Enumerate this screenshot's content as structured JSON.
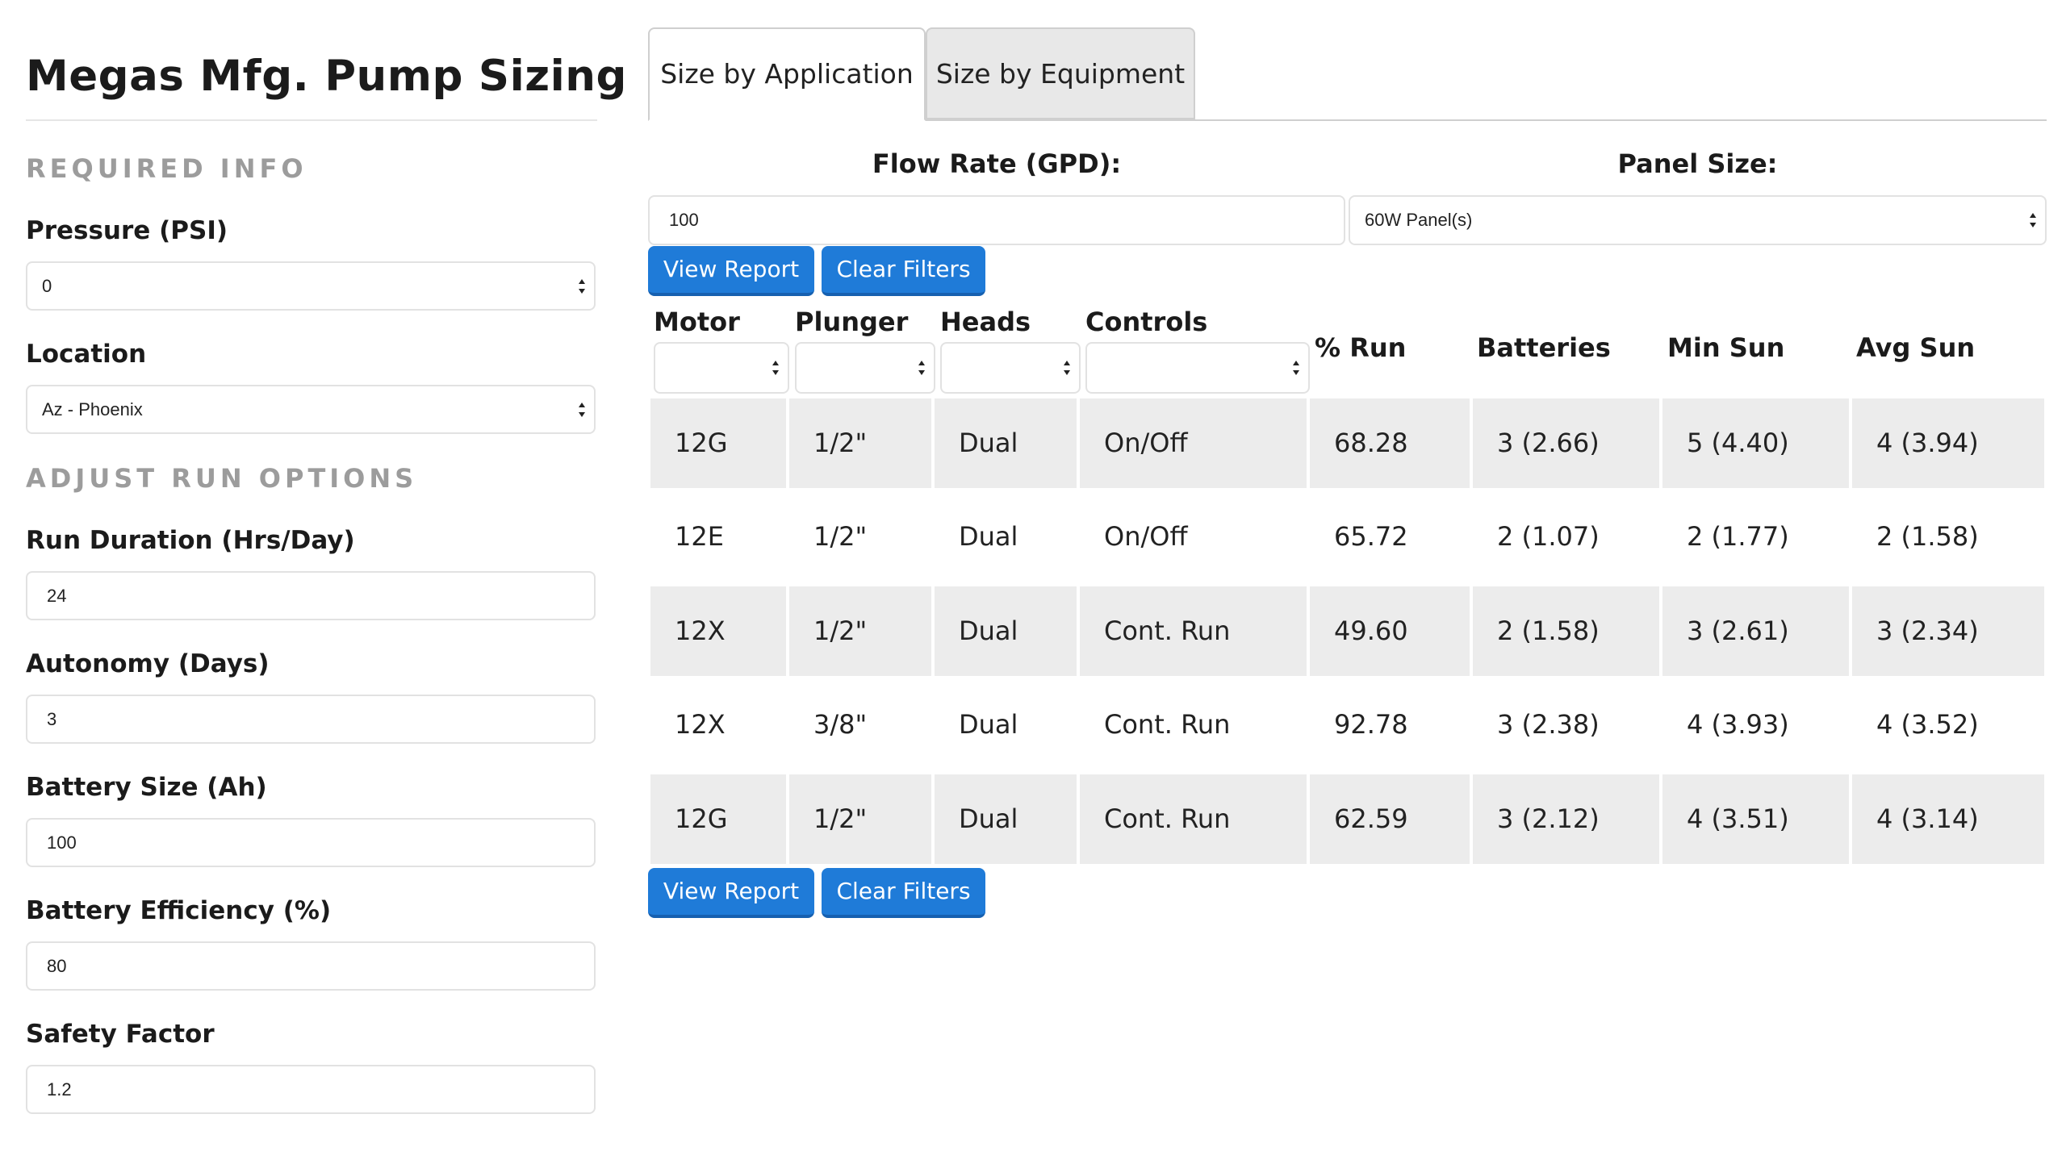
{
  "app": {
    "title": "Megas Mfg. Pump Sizing"
  },
  "sidebar": {
    "required_heading": "REQUIRED INFO",
    "pressure": {
      "label": "Pressure (PSI)",
      "value": "0"
    },
    "location": {
      "label": "Location",
      "value": "Az - Phoenix"
    },
    "adjust_heading": "ADJUST RUN OPTIONS",
    "run_duration": {
      "label": "Run Duration (Hrs/Day)",
      "value": "24"
    },
    "autonomy": {
      "label": "Autonomy (Days)",
      "value": "3"
    },
    "battery_size": {
      "label": "Battery Size (Ah)",
      "value": "100"
    },
    "battery_efficiency": {
      "label": "Battery Efficiency (%)",
      "value": "80"
    },
    "safety_factor": {
      "label": "Safety Factor",
      "value": "1.2"
    }
  },
  "tabs": [
    {
      "label": "Size by Application",
      "active": true
    },
    {
      "label": "Size by Equipment",
      "active": false
    }
  ],
  "filters": {
    "flow_rate": {
      "label": "Flow Rate (GPD):",
      "value": "100"
    },
    "panel_size": {
      "label": "Panel Size:",
      "value": "60W Panel(s)"
    }
  },
  "buttons": {
    "view_report": "View Report",
    "clear_filters": "Clear Filters"
  },
  "table": {
    "columns": [
      "Motor",
      "Plunger",
      "Heads",
      "Controls",
      "% Run",
      "Batteries",
      "Min Sun",
      "Avg Sun"
    ],
    "filter_selects": {
      "motor": "",
      "plunger": "",
      "heads": "",
      "controls": ""
    },
    "rows": [
      [
        "12G",
        "1/2\"",
        "Dual",
        "On/Off",
        "68.28",
        "3 (2.66)",
        "5 (4.40)",
        "4 (3.94)"
      ],
      [
        "12E",
        "1/2\"",
        "Dual",
        "On/Off",
        "65.72",
        "2 (1.07)",
        "2 (1.77)",
        "2 (1.58)"
      ],
      [
        "12X",
        "1/2\"",
        "Dual",
        "Cont. Run",
        "49.60",
        "2 (1.58)",
        "3 (2.61)",
        "3 (2.34)"
      ],
      [
        "12X",
        "3/8\"",
        "Dual",
        "Cont. Run",
        "92.78",
        "3 (2.38)",
        "4 (3.93)",
        "4 (3.52)"
      ],
      [
        "12G",
        "1/2\"",
        "Dual",
        "Cont. Run",
        "62.59",
        "3 (2.12)",
        "4 (3.51)",
        "4 (3.14)"
      ]
    ]
  },
  "colors": {
    "button": "#1f7bd8",
    "row_shade": "#ececec",
    "section_heading": "#9c9c9c"
  }
}
